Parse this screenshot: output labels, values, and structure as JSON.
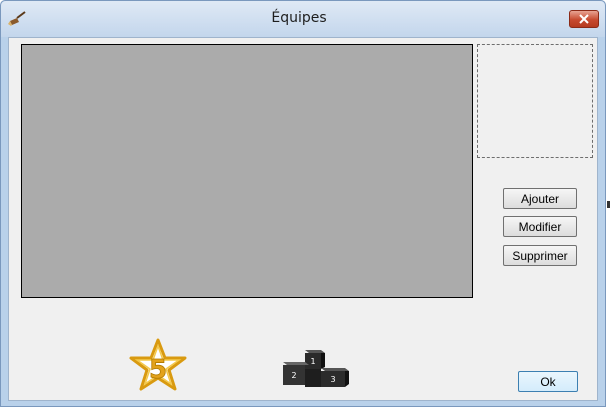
{
  "window": {
    "title": "Équipes",
    "app_icon": "broom-icon",
    "close_icon": "close-icon"
  },
  "preview": {
    "placeholder": ""
  },
  "actions": {
    "add_label": "Ajouter",
    "edit_label": "Modifier",
    "delete_label": "Supprimer",
    "ok_label": "Ok"
  },
  "footer_icons": {
    "star": {
      "icon": "star-five-icon",
      "number": "5"
    },
    "podium": {
      "icon": "podium-icon",
      "places": [
        "1",
        "2",
        "3"
      ]
    }
  },
  "colors": {
    "titlebar": "#c3d6ec",
    "client": "#f0f0f0",
    "grid": "#ababab",
    "close": "#c74a2f",
    "star": "#e3a21a"
  }
}
